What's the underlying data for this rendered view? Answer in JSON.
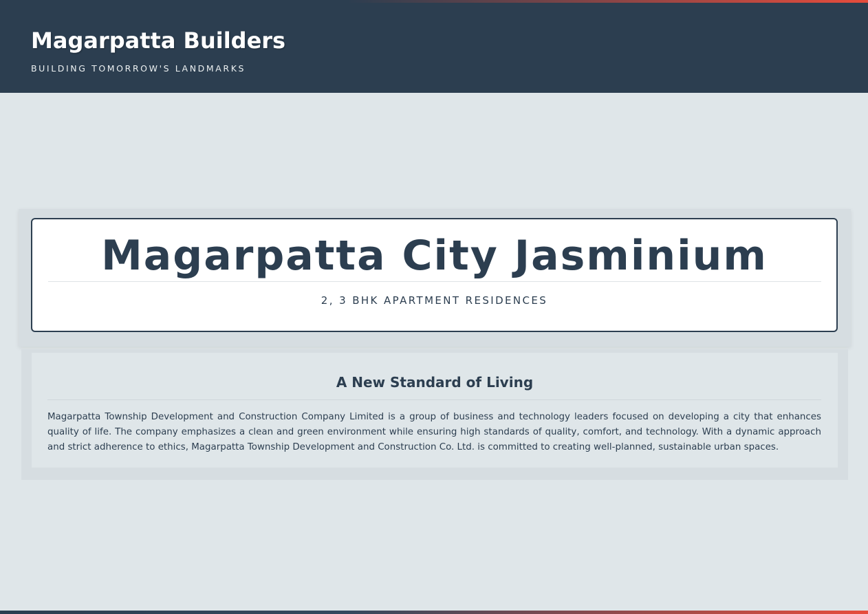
{
  "header": {
    "title": "Magarpatta Builders",
    "tagline": "BUILDING TOMORROW'S LANDMARKS"
  },
  "hero": {
    "project_name": "Magarpatta City Jasminium",
    "project_type": "2, 3 BHK APARTMENT RESIDENCES"
  },
  "about": {
    "heading": "A New Standard of Living",
    "body": "Magarpatta Township Development and Construction Company Limited is a group of business and technology leaders focused on developing a city that enhances quality of life. The company emphasizes a clean and green environment while ensuring high standards of quality, comfort, and technology. With a dynamic approach and strict adherence to ethics, Magarpatta Township Development and Construction Co. Ltd. is committed to creating well-planned, sustainable urban spaces."
  },
  "colors": {
    "primary": "#2c3e50",
    "accent": "#e74c3c",
    "background": "#dfe6e9"
  }
}
